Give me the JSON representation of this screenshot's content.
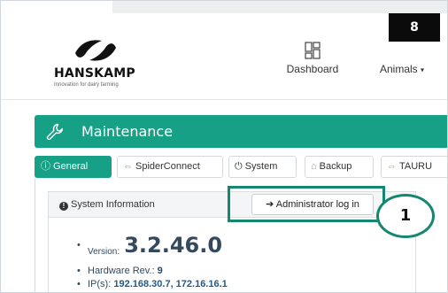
{
  "header": {
    "brand": {
      "name": "HANSKAMP",
      "tagline": "Innovation for dairy farming",
      "icon": "hanskamp-logo-mark"
    },
    "nav": [
      {
        "label": "Dashboard",
        "icon": "dashboard-grid-icon"
      },
      {
        "label": "Animals",
        "icon": "cow-icon",
        "caret": "▾"
      }
    ],
    "badge": "8"
  },
  "panel": {
    "title": "Maintenance",
    "icon": "wrench-icon",
    "color": "#16a085"
  },
  "tabs": [
    {
      "label": "General",
      "icon": "info-circle-icon",
      "active": true
    },
    {
      "label": "SpiderConnect",
      "icon": "link-icon"
    },
    {
      "label": "System",
      "icon": "power-icon"
    },
    {
      "label": "Backup",
      "icon": "backup-drive-icon"
    },
    {
      "label": "TAURU",
      "icon": "link-icon"
    }
  ],
  "system_info": {
    "header_label": "System Information",
    "header_icon": "info-icon",
    "admin_button": {
      "label": "Administrator log in",
      "icon": "sign-in-icon"
    },
    "callout_number": "1",
    "version_label": "Version:",
    "version_value": "3.2.46.0",
    "hardware_label": "Hardware Rev.:",
    "hardware_value": "9",
    "ip_label": "IP(s):",
    "ip_value": "192.168.30.7, 172.16.16.1"
  },
  "colors": {
    "accent": "#16a085",
    "highlight": "#15866f",
    "badge_bg": "#0b0b0b"
  }
}
